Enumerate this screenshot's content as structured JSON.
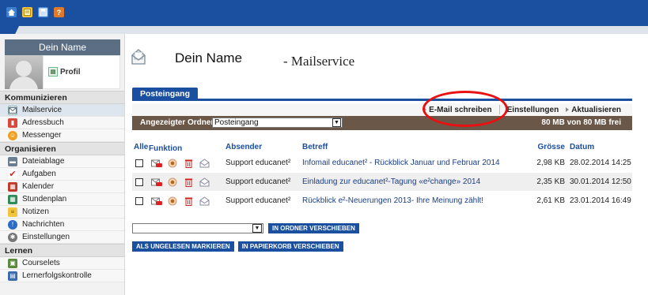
{
  "header": {
    "toolbar_icons": [
      "home-icon",
      "notes-icon",
      "save-icon",
      "help-icon"
    ],
    "colors": {
      "brand": "#1b4fa0",
      "folder_bar": "#6a5748",
      "highlight_ring": "#e81010"
    }
  },
  "sidebar": {
    "user_name": "Dein Name",
    "profile_label": "Profil",
    "sections": [
      {
        "title": "Kommunizieren",
        "items": [
          {
            "label": "Mailservice",
            "icon": "mail-icon",
            "active": true
          },
          {
            "label": "Adressbuch",
            "icon": "address-book-icon"
          },
          {
            "label": "Messenger",
            "icon": "messenger-icon"
          }
        ]
      },
      {
        "title": "Organisieren",
        "items": [
          {
            "label": "Dateiablage",
            "icon": "folder-icon"
          },
          {
            "label": "Aufgaben",
            "icon": "tasks-icon"
          },
          {
            "label": "Kalender",
            "icon": "calendar-icon"
          },
          {
            "label": "Stundenplan",
            "icon": "timetable-icon"
          },
          {
            "label": "Notizen",
            "icon": "notes-icon"
          },
          {
            "label": "Nachrichten",
            "icon": "news-icon"
          },
          {
            "label": "Einstellungen",
            "icon": "settings-icon"
          }
        ]
      },
      {
        "title": "Lernen",
        "items": [
          {
            "label": "Courselets",
            "icon": "courselets-icon"
          },
          {
            "label": "Lernerfolgskontrolle",
            "icon": "learning-control-icon"
          }
        ]
      }
    ]
  },
  "main": {
    "title_name": "Dein Name",
    "title_service": "- Mailservice",
    "tab": "Posteingang",
    "actions": {
      "compose": "E-Mail schreiben",
      "settings": "Einstellungen",
      "refresh": "Aktualisieren"
    },
    "folder": {
      "label": "Angezeigter Ordner",
      "selected": "Posteingang",
      "quota": "80 MB von 80 MB frei"
    },
    "table": {
      "headers": {
        "all": "Alle",
        "function": "Funktion",
        "sender": "Absender",
        "subject": "Betreff",
        "size": "Grösse",
        "date": "Datum"
      },
      "rows": [
        {
          "sender": "Support educanet²",
          "subject": "Infomail educanet² - Rückblick Januar und Februar 2014",
          "size": "2,98 KB",
          "date": "28.02.2014 14:25"
        },
        {
          "sender": "Support educanet²",
          "subject": "Einladung zur educanet²-Tagung «e²change» 2014",
          "size": "2,35 KB",
          "date": "30.01.2014 12:50"
        },
        {
          "sender": "Support educanet²",
          "subject": "Rückblick e²-Neuerungen 2013- Ihre Meinung zählt!",
          "size": "2,61 KB",
          "date": "23.01.2014 16:49"
        }
      ]
    },
    "move_button": "IN ORDNER VERSCHIEBEN",
    "mark_unread_button": "ALS UNGELESEN MARKIEREN",
    "trash_button": "IN PAPIERKORB VERSCHIEBEN"
  }
}
